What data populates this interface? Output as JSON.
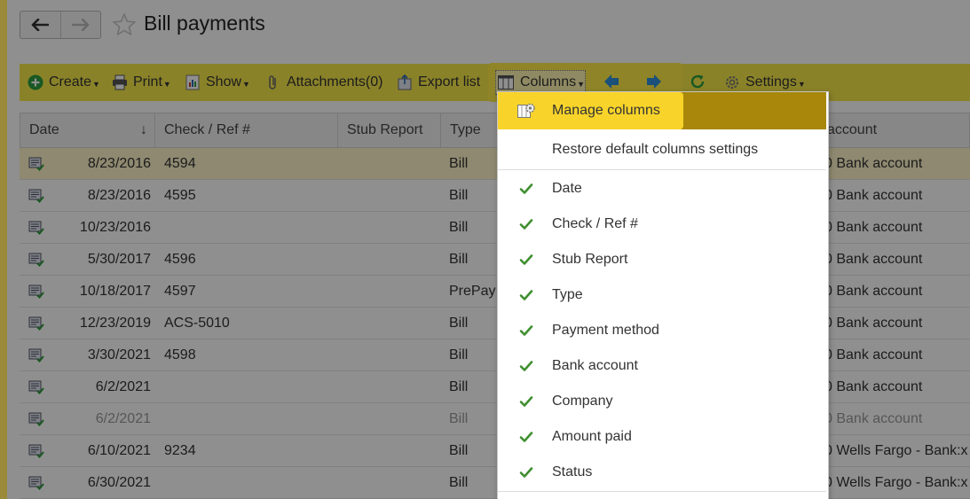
{
  "header": {
    "title": "Bill payments"
  },
  "toolbar": {
    "create": "Create",
    "print": "Print",
    "show": "Show",
    "attachments": "Attachments(0)",
    "export": "Export list",
    "columns": "Columns",
    "settings": "Settings"
  },
  "table": {
    "headers": [
      "Date",
      "Check / Ref #",
      "Stub Report",
      "Type",
      "account"
    ],
    "sort_indicator": "↓",
    "rows": [
      {
        "date": "8/23/2016",
        "ref": "4594",
        "type": "Bill",
        "account": "0 Bank account"
      },
      {
        "date": "8/23/2016",
        "ref": "4595",
        "type": "Bill",
        "account": "0 Bank account"
      },
      {
        "date": "10/23/2016",
        "ref": "",
        "type": "Bill",
        "account": "0 Bank account"
      },
      {
        "date": "5/30/2017",
        "ref": "4596",
        "type": "Bill",
        "account": "0 Bank account"
      },
      {
        "date": "10/18/2017",
        "ref": "4597",
        "type": "PrePay",
        "account": "0 Bank account"
      },
      {
        "date": "12/23/2019",
        "ref": "ACS-5010",
        "type": "Bill",
        "account": "0 Bank account"
      },
      {
        "date": "3/30/2021",
        "ref": "4598",
        "type": "Bill",
        "account": "0 Bank account"
      },
      {
        "date": "6/2/2021",
        "ref": "",
        "type": "Bill",
        "account": "0 Bank account"
      },
      {
        "date": "6/2/2021",
        "ref": "",
        "type": "Bill",
        "account": "0 Bank account"
      },
      {
        "date": "6/10/2021",
        "ref": "9234",
        "type": "Bill",
        "account": "0 Wells Fargo - Bank:x"
      },
      {
        "date": "6/30/2021",
        "ref": "",
        "type": "Bill",
        "account": "0 Wells Fargo - Bank:x"
      }
    ]
  },
  "columns_menu": {
    "manage": "Manage columns",
    "restore": "Restore default columns settings",
    "items": [
      "Date",
      "Check / Ref #",
      "Stub Report",
      "Type",
      "Payment method",
      "Bank account",
      "Company",
      "Amount paid",
      "Status"
    ]
  },
  "colors": {
    "toolbar_bg": "#f6e84a",
    "highlight": "#ffeb46",
    "check_green": "#3f8f2f",
    "arrow_blue": "#2f8fd8"
  }
}
